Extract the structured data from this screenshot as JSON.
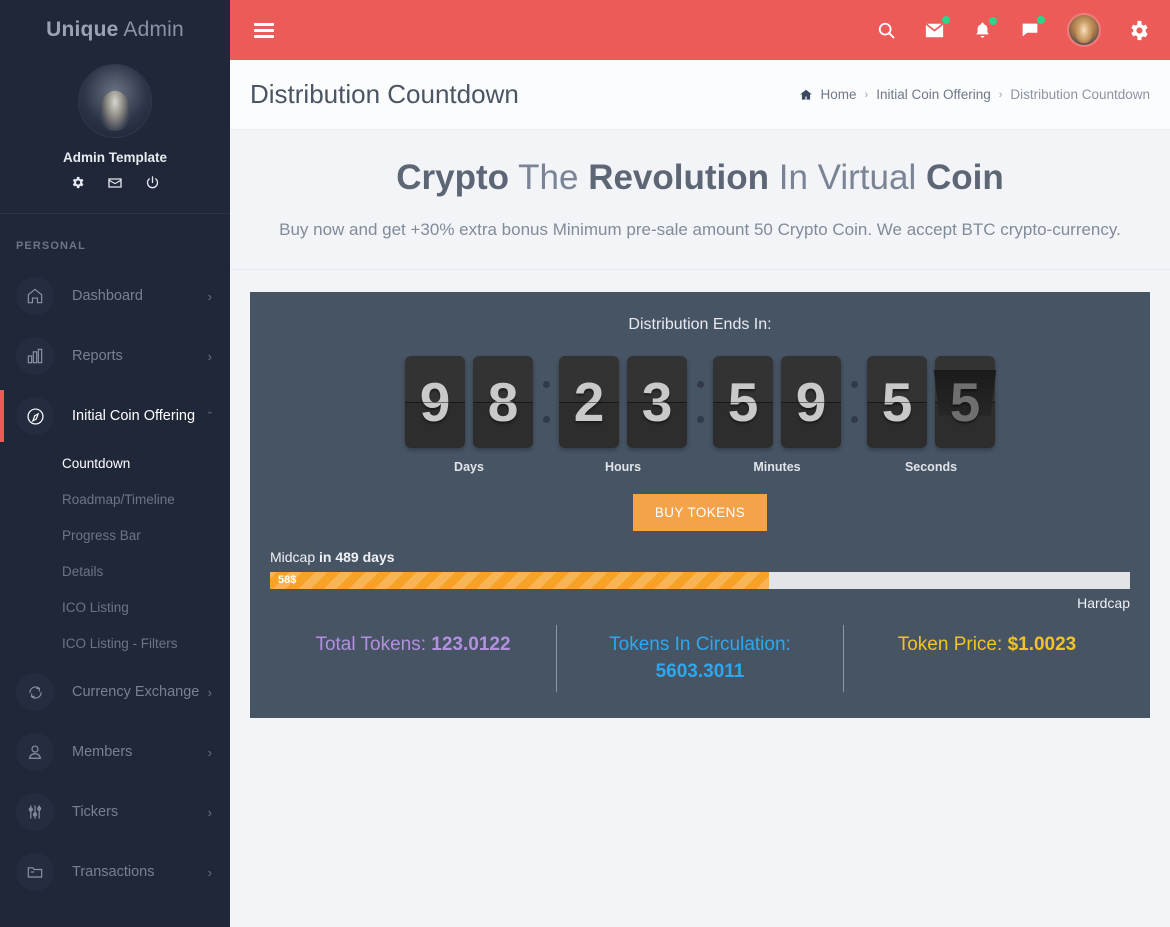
{
  "sidebar": {
    "brand_bold": "Unique",
    "brand_light": " Admin",
    "profile_name": "Admin Template",
    "profile_icons": [
      "gear-icon",
      "envelope-icon",
      "power-icon"
    ],
    "section_label": "PERSONAL",
    "items": [
      {
        "label": "Dashboard",
        "icon": "home-icon",
        "arrow": "›"
      },
      {
        "label": "Reports",
        "icon": "bar-chart-icon",
        "arrow": "›"
      },
      {
        "label": "Initial Coin Offering",
        "icon": "compass-icon",
        "arrow": "ˇ",
        "active": true
      },
      {
        "label": "Currency Exchange",
        "icon": "refresh-icon",
        "arrow": "›"
      },
      {
        "label": "Members",
        "icon": "user-icon",
        "arrow": "›"
      },
      {
        "label": "Tickers",
        "icon": "sliders-icon",
        "arrow": "›"
      },
      {
        "label": "Transactions",
        "icon": "folder-icon",
        "arrow": "›"
      }
    ],
    "subitems": [
      {
        "label": "Countdown",
        "active": true
      },
      {
        "label": "Roadmap/Timeline",
        "active": false
      },
      {
        "label": "Progress Bar",
        "active": false
      },
      {
        "label": "Details",
        "active": false
      },
      {
        "label": "ICO Listing",
        "active": false
      },
      {
        "label": "ICO Listing - Filters",
        "active": false
      }
    ],
    "active_color": "#ec5b58"
  },
  "topbar": {
    "background": "#ec5b58",
    "menu_icon": "hamburger-icon",
    "icons": [
      {
        "name": "search-icon",
        "badge": false
      },
      {
        "name": "envelope-icon",
        "badge": true
      },
      {
        "name": "bell-icon",
        "badge": true
      },
      {
        "name": "chat-icon",
        "badge": true
      }
    ],
    "badge_color": "#2fd38a",
    "avatar": "user-avatar",
    "settings_icon": "gear-icon"
  },
  "pagehead": {
    "title": "Distribution Countdown",
    "breadcrumb": {
      "home_icon": "home-icon",
      "items": [
        "Home",
        "Initial Coin Offering",
        "Distribution Countdown"
      ],
      "separator": "›"
    }
  },
  "hero": {
    "title_parts": [
      {
        "text": "Crypto",
        "bold": true
      },
      {
        "text": " The ",
        "bold": false
      },
      {
        "text": "Revolution",
        "bold": true
      },
      {
        "text": " In Virtual ",
        "bold": false
      },
      {
        "text": "Coin",
        "bold": true
      }
    ],
    "subtitle": "Buy now and get +30% extra bonus Minimum pre-sale amount 50 Crypto Coin. We accept BTC crypto-currency."
  },
  "card": {
    "title": "Distribution Ends In:",
    "countdown": {
      "units": [
        {
          "label": "Days",
          "digits": [
            "9",
            "8"
          ],
          "value": 98
        },
        {
          "label": "Hours",
          "digits": [
            "2",
            "3"
          ],
          "value": 23
        },
        {
          "label": "Minutes",
          "digits": [
            "5",
            "9"
          ],
          "value": 59
        },
        {
          "label": "Seconds",
          "digits": [
            "5",
            "5"
          ],
          "value": 55,
          "flipping_last": true
        }
      ]
    },
    "buy_button": "BUY TOKENS",
    "progress": {
      "midcap_label": "Midcap",
      "midcap_bold": "in 489 days",
      "bar_text": "58$",
      "percent": 58,
      "hardcap_label": "Hardcap",
      "fill_color": "#f5a226",
      "track_color": "#e2e4e8"
    },
    "stats": [
      {
        "label": "Total Tokens: ",
        "value": "123.0122",
        "color": "#b38fe0"
      },
      {
        "label": "Tokens In Circulation: ",
        "value": "5603.3011",
        "color": "#2ca8f0"
      },
      {
        "label": "Token Price: ",
        "value": "$1.0023",
        "color": "#f2c327"
      }
    ]
  }
}
